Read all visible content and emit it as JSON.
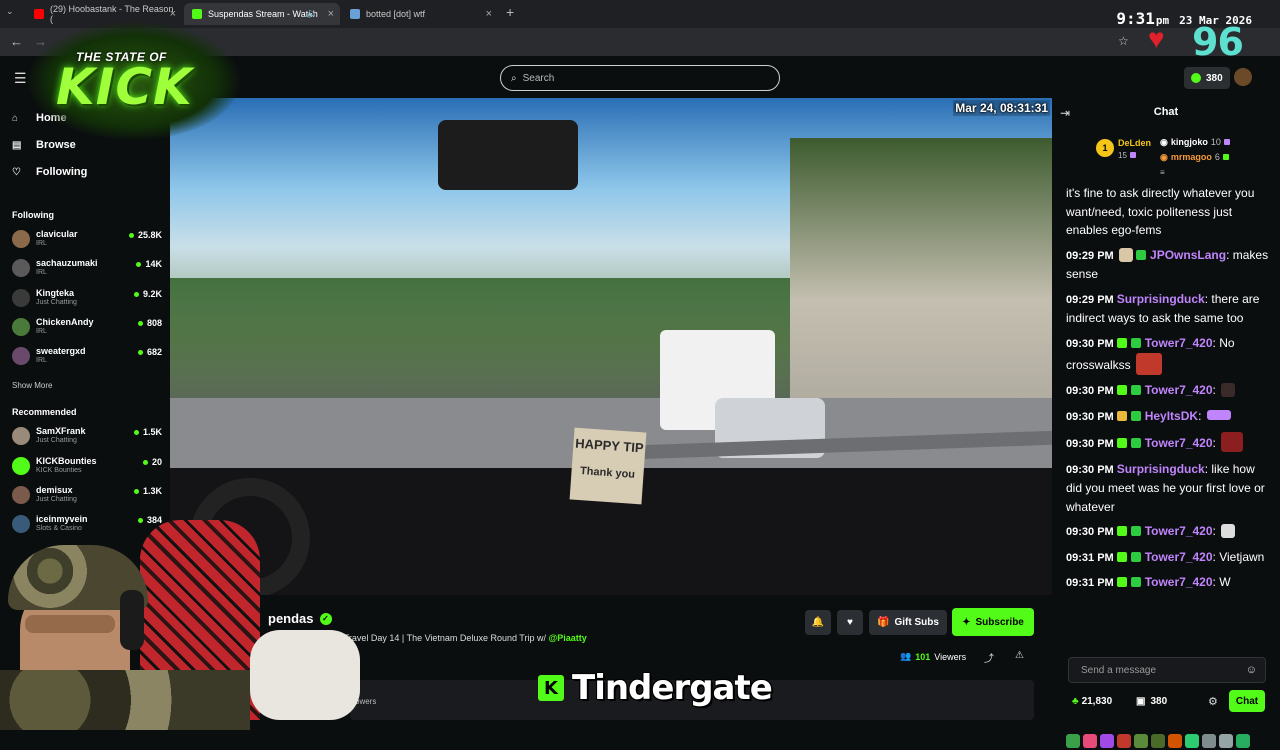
{
  "browser": {
    "tabs": [
      {
        "title": "(29) Hoobastank - The Reason (",
        "favicon_color": "#ff0000",
        "active": false
      },
      {
        "title": "Suspendas Stream - Watch",
        "favicon_color": "#53fc18",
        "active": true
      },
      {
        "title": "botted [dot] wtf",
        "favicon_color": "#6aa0d8",
        "active": false
      }
    ],
    "clock_time": "9:31",
    "clock_ampm": "pm",
    "clock_date": "23 Mar 2026",
    "overlay_number": "96"
  },
  "logo": {
    "top_text": "THE STATE OF",
    "main_text": "KICK"
  },
  "header": {
    "search_placeholder": "Search",
    "points": "380"
  },
  "sidebar": {
    "nav": [
      {
        "label": "Home",
        "icon": "home-icon"
      },
      {
        "label": "Browse",
        "icon": "browse-icon"
      },
      {
        "label": "Following",
        "icon": "heart-icon"
      }
    ],
    "following_title": "Following",
    "following": [
      {
        "name": "clavicular",
        "category": "IRL",
        "viewers": "25.8K",
        "avatar_color": "#8a6a4a"
      },
      {
        "name": "sachauzumaki",
        "category": "IRL",
        "viewers": "14K",
        "avatar_color": "#5a5a5a"
      },
      {
        "name": "Kingteka",
        "category": "Just Chatting",
        "viewers": "9.2K",
        "avatar_color": "#3a3a3a"
      },
      {
        "name": "ChickenAndy",
        "category": "IRL",
        "viewers": "808",
        "avatar_color": "#4a7a3a"
      },
      {
        "name": "sweatergxd",
        "category": "IRL",
        "viewers": "682",
        "avatar_color": "#6a4a6a"
      }
    ],
    "show_more": "Show More",
    "recommended_title": "Recommended",
    "recommended": [
      {
        "name": "SamXFrank",
        "category": "Just Chatting",
        "viewers": "1.5K",
        "avatar_color": "#9a8a7a"
      },
      {
        "name": "KICKBounties",
        "category": "KICK Bounties",
        "viewers": "20",
        "avatar_color": "#53fc18"
      },
      {
        "name": "demisux",
        "category": "Just Chatting",
        "viewers": "1.3K",
        "avatar_color": "#7a5a4a"
      },
      {
        "name": "iceinmyvein",
        "category": "Slots & Casino",
        "viewers": "384",
        "avatar_color": "#3a5a7a"
      }
    ]
  },
  "video": {
    "timestamp": "Mar 24, 08:31:31",
    "sign_text_1": "HAPPY TIP",
    "sign_text_2": "Thank you"
  },
  "stream": {
    "streamer_name": "pendas",
    "title_prefix": "[vi] 2.0 | Travel Day 14",
    "title_main": " | The Vietnam Deluxe Round Trip w/ ",
    "title_mention": "@Piaatty",
    "tag": "sh",
    "followers_label": "owers",
    "gift_label": "Gift Subs",
    "subscribe_label": "Subscribe",
    "viewers_count": "101",
    "viewers_label": "Viewers"
  },
  "overlay_caption": "Tindergate",
  "chat": {
    "title": "Chat",
    "leaderboard": {
      "first_rank": "1",
      "first_name": "DeLden",
      "first_count": "15",
      "second_name": "kingjoko",
      "second_count": "10",
      "third_name": "mrmagoo",
      "third_count": "6"
    },
    "messages": [
      {
        "time": "",
        "user": "",
        "user_color": "#ffffff",
        "text": "it's fine to ask directly whatever you want/need, toxic politeness just enables ego-fems"
      },
      {
        "time": "09:29 PM",
        "user": "JPOwnsLang",
        "user_color": "#c084fc",
        "text": "makes sense"
      },
      {
        "time": "09:29 PM",
        "user": "Surprisingduck",
        "user_color": "#c084fc",
        "text": "there are indirect ways to ask the same too"
      },
      {
        "time": "09:30 PM",
        "user": "Tower7_420",
        "user_color": "#c084fc",
        "text": "No crosswalkss"
      },
      {
        "time": "09:30 PM",
        "user": "Tower7_420",
        "user_color": "#c084fc",
        "text": ""
      },
      {
        "time": "09:30 PM",
        "user": "HeyItsDK",
        "user_color": "#c084fc",
        "text": ""
      },
      {
        "time": "09:30 PM",
        "user": "Tower7_420",
        "user_color": "#c084fc",
        "text": ""
      },
      {
        "time": "09:30 PM",
        "user": "Surprisingduck",
        "user_color": "#c084fc",
        "text": "like how did you meet was he your first love or whatever"
      },
      {
        "time": "09:30 PM",
        "user": "Tower7_420",
        "user_color": "#c084fc",
        "text": ""
      },
      {
        "time": "09:31 PM",
        "user": "Tower7_420",
        "user_color": "#c084fc",
        "text": "Vietjawn"
      },
      {
        "time": "09:31 PM",
        "user": "Tower7_420",
        "user_color": "#c084fc",
        "text": "W"
      }
    ],
    "input_placeholder": "Send a message",
    "kick_points": "21,830",
    "channel_points": "380",
    "chat_button": "Chat"
  }
}
